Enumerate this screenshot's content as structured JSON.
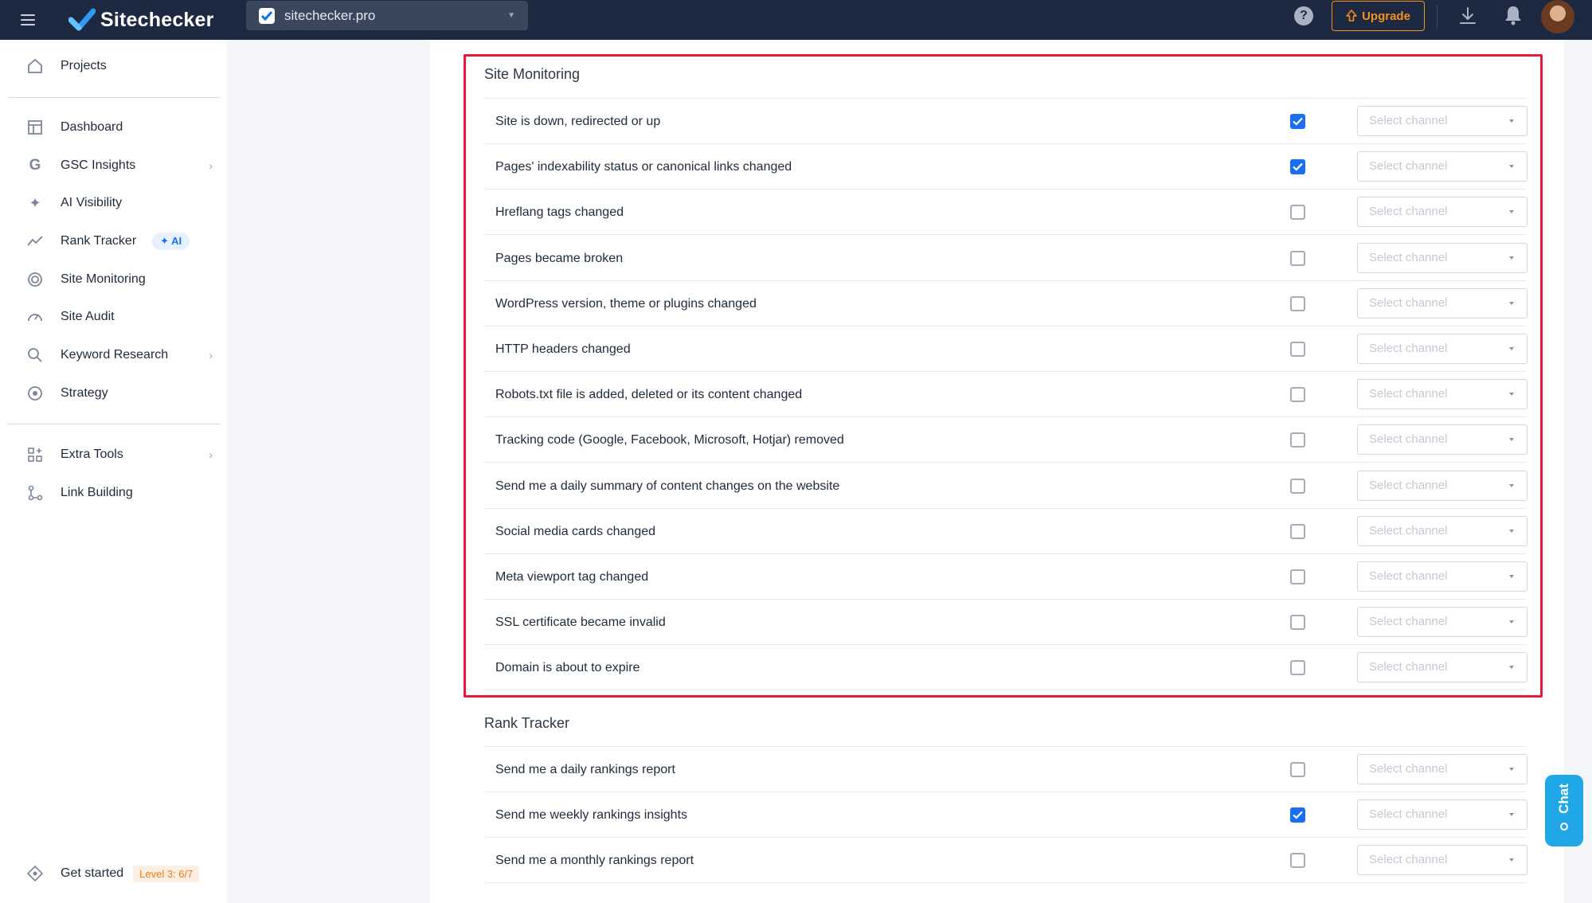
{
  "app": {
    "name": "Sitechecker",
    "project": "sitechecker.pro"
  },
  "topbar": {
    "upgrade_label": "Upgrade",
    "help_glyph": "?"
  },
  "sidebar": {
    "items": [
      {
        "label": "Projects",
        "icon": "home-icon"
      },
      {
        "label": "Dashboard",
        "icon": "dashboard-icon"
      },
      {
        "label": "GSC Insights",
        "icon": "google-icon"
      },
      {
        "label": "AI Visibility",
        "icon": "sparkle-icon"
      },
      {
        "label": "Rank Tracker",
        "icon": "trend-icon",
        "badge": "✦ AI"
      },
      {
        "label": "Site Monitoring",
        "icon": "monitoring-icon"
      },
      {
        "label": "Site Audit",
        "icon": "gauge-icon"
      },
      {
        "label": "Keyword Research",
        "icon": "keyword-icon"
      },
      {
        "label": "Strategy",
        "icon": "target-icon"
      },
      {
        "label": "Extra Tools",
        "icon": "tools-icon"
      },
      {
        "label": "Link Building",
        "icon": "link-building-icon"
      }
    ],
    "get_started": {
      "label": "Get started",
      "level": "Level 3: 6/7"
    }
  },
  "sections": {
    "site_monitoring": {
      "title": "Site Monitoring",
      "rows": [
        {
          "label": "Site is down, redirected or up",
          "checked": true
        },
        {
          "label": "Pages' indexability status or canonical links changed",
          "checked": true
        },
        {
          "label": "Hreflang tags changed",
          "checked": false
        },
        {
          "label": "Pages became broken",
          "checked": false
        },
        {
          "label": "WordPress version, theme or plugins changed",
          "checked": false
        },
        {
          "label": "HTTP headers changed",
          "checked": false
        },
        {
          "label": "Robots.txt file is added, deleted or its content changed",
          "checked": false
        },
        {
          "label": "Tracking code (Google, Facebook, Microsoft, Hotjar) removed",
          "checked": false
        },
        {
          "label": "Send me a daily summary of content changes on the website",
          "checked": false
        },
        {
          "label": "Social media cards changed",
          "checked": false
        },
        {
          "label": "Meta viewport tag changed",
          "checked": false
        },
        {
          "label": "SSL certificate became invalid",
          "checked": false
        },
        {
          "label": "Domain is about to expire",
          "checked": false
        }
      ]
    },
    "rank_tracker": {
      "title": "Rank Tracker",
      "rows": [
        {
          "label": "Send me a daily rankings report",
          "checked": false
        },
        {
          "label": "Send me weekly rankings insights",
          "checked": true
        },
        {
          "label": "Send me a monthly rankings report",
          "checked": false
        }
      ]
    }
  },
  "channel_placeholder": "Select channel",
  "chat": {
    "label": "Chat"
  },
  "colors": {
    "accent": "#1a6ff0",
    "topbar": "#1d2940",
    "upgrade": "#f5901f",
    "highlight": "#e8183a",
    "chat": "#1fa7e8"
  }
}
